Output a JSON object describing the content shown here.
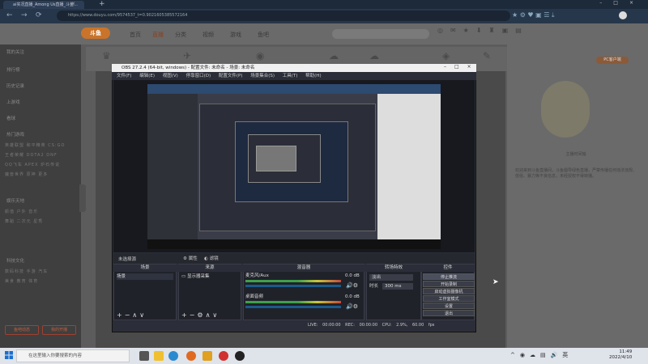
{
  "browser": {
    "tab_title": "ai实况直播_Among Us直播_斗鱼…",
    "url": "https://www.douyu.com/9574537_t=0.9021605385572164"
  },
  "site": {
    "logo": "斗鱼",
    "nav": [
      "首页",
      "直播",
      "分类",
      "视频",
      "游戏",
      "鱼吧"
    ],
    "sidebar_items": [
      "我的关注",
      "排行榜",
      "历史记录",
      "上游戏",
      "看球"
    ],
    "sidebar_section1": "热门游戏",
    "sidebar_grid1": [
      "英雄联盟",
      "和平精英",
      "CS:GO",
      "王者荣耀",
      "DOTA2",
      "DNF",
      "QQ飞车",
      "APEX",
      "炉石传说",
      "魔兽世界",
      "原神",
      "更多"
    ],
    "sidebar_section2": "娱乐天地",
    "sidebar_grid2": [
      "颜值",
      "户外",
      "音乐",
      "舞蹈",
      "二次元",
      "星秀"
    ],
    "sidebar_section3": "科技文化",
    "sidebar_grid3": [
      "数码科技",
      "手游",
      "汽车",
      "美食",
      "教育",
      "体育"
    ],
    "sidebar_btn_left": "鱼吧动态",
    "sidebar_btn_right": "我的开播",
    "right_panel_title": "主播时间轴",
    "right_panel_text": "欢迎来到斗鱼直播间，斗鱼倡导绿色直播，严禁传播任何违法违规、低俗、暴力等不良信息，未经授权不得转播。",
    "right_panel_tag": "PC客户端"
  },
  "obs": {
    "title": "OBS 27.2.4 (64-bit, windows) - 配置文件: 未命名 - 场景: 未命名",
    "menu": [
      "文件(F)",
      "编辑(E)",
      "视图(V)",
      "停靠窗口(D)",
      "配置文件(P)",
      "场景集合(S)",
      "工具(T)",
      "帮助(H)"
    ],
    "strip_label": "未选择源",
    "strip_btn1": "属性",
    "strip_btn2": "滤镜",
    "docks": {
      "scenes": {
        "title": "场景",
        "items": [
          "场景"
        ]
      },
      "sources": {
        "title": "来源",
        "items": [
          "显示器采集"
        ]
      },
      "mixer": {
        "title": "混音器",
        "tracks": [
          {
            "name": "麦克风/Aux",
            "db": "0.0 dB"
          },
          {
            "name": "桌面音频",
            "db": "0.0 dB"
          }
        ]
      },
      "transitions": {
        "title": "转场特效",
        "type": "淡出",
        "duration_label": "时长",
        "duration": "300 ms"
      },
      "controls": {
        "title": "控件",
        "buttons": [
          "停止推流",
          "开始录制",
          "启动虚拟摄像机",
          "工作室模式",
          "设置",
          "退出"
        ]
      }
    },
    "status": {
      "live": "LIVE: 00:00:00",
      "rec": "REC: 00:00:00",
      "cpu": "CPU: 2.9%, 60.00 fps"
    }
  },
  "taskbar": {
    "search_placeholder": "在这里输入你要搜索的内容",
    "time": "11:49",
    "date": "2022/4/10"
  }
}
